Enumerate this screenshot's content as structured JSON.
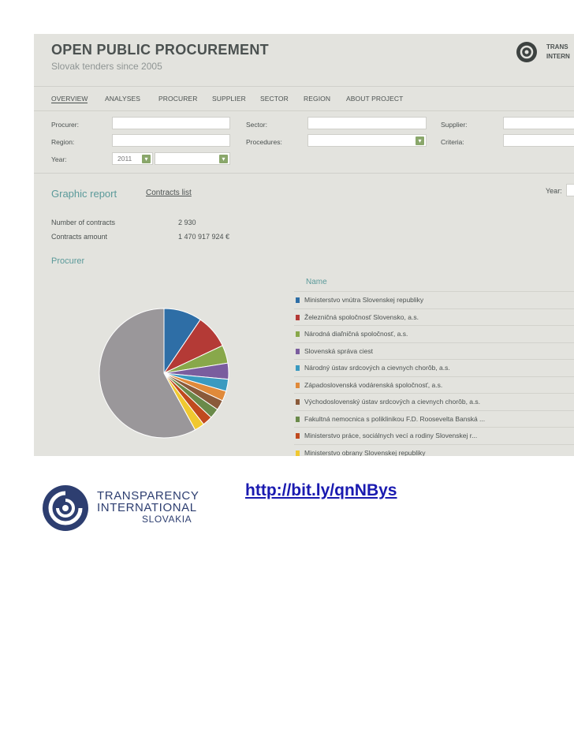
{
  "header": {
    "title": "OPEN PUBLIC PROCUREMENT",
    "subtitle": "Slovak tenders since 2005",
    "logo_text": "TRANS\nINTERN"
  },
  "nav": {
    "items": [
      {
        "label": "OVERVIEW",
        "active": true
      },
      {
        "label": "ANALYSES"
      },
      {
        "label": "PROCURER"
      },
      {
        "label": "SUPPLIER"
      },
      {
        "label": "SECTOR"
      },
      {
        "label": "REGION"
      },
      {
        "label": "ABOUT PROJECT"
      }
    ]
  },
  "filters": {
    "procurer_label": "Procurer:",
    "region_label": "Region:",
    "year_label": "Year:",
    "year_value": "2011",
    "sector_label": "Sector:",
    "procedures_label": "Procedures:",
    "supplier_label": "Supplier:",
    "criteria_label": "Criteria:"
  },
  "tabs": {
    "graphic": "Graphic report",
    "list": "Contracts list",
    "year_label": "Year:"
  },
  "stats": {
    "contracts_label": "Number of contracts",
    "contracts_value": "2 930",
    "amount_label": "Contracts amount",
    "amount_value": "1 470 917 924 €"
  },
  "chart_section": {
    "title": "Procurer",
    "legend_header": "Name"
  },
  "chart_data": {
    "type": "pie",
    "title": "",
    "series": [
      {
        "name": "Ministerstvo vnútra Slovenskej republiky",
        "value": 9.5,
        "color": "#2e6ea6"
      },
      {
        "name": "Železničná spoločnosť Slovensko, a.s.",
        "value": 8.5,
        "color": "#b43a36"
      },
      {
        "name": "Národná diaľničná spoločnosť, a.s.",
        "value": 4.5,
        "color": "#88a84a"
      },
      {
        "name": "Slovenská správa ciest",
        "value": 4,
        "color": "#7a5d9e"
      },
      {
        "name": "Národný ústav srdcových a cievnych chorôb, a.s.",
        "value": 3,
        "color": "#3a9ac0"
      },
      {
        "name": "Západoslovenská vodárenská spoločnosť, a.s.",
        "value": 2.5,
        "color": "#e08a3a"
      },
      {
        "name": "Východoslovenský ústav srdcových a cievnych chorôb, a.s.",
        "value": 2.5,
        "color": "#8a5a3a"
      },
      {
        "name": "Fakultná nemocnica s poliklinikou F.D. Roosevelta Banská ...",
        "value": 2.5,
        "color": "#6a8a4a"
      },
      {
        "name": "Ministerstvo práce, sociálnych vecí a rodiny Slovenskej r...",
        "value": 2.5,
        "color": "#c04a1e"
      },
      {
        "name": "Ministerstvo obrany Slovenskej republiky",
        "value": 2.5,
        "color": "#f0c830"
      },
      {
        "name": "",
        "value": 58,
        "color": "#9a979a"
      }
    ]
  },
  "footer": {
    "ti_line1": "TRANSPARENCY",
    "ti_line2": "INTERNATIONAL",
    "ti_line3": "SLOVAKIA",
    "link": "http://bit.ly/qnNBys"
  }
}
